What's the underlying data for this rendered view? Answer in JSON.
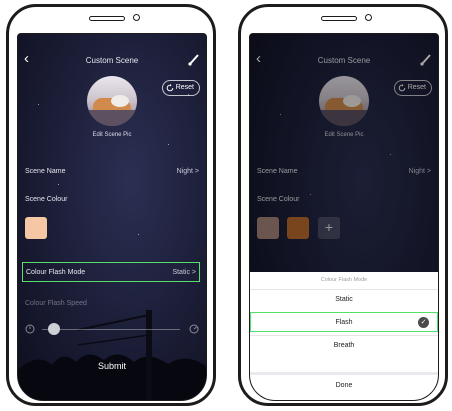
{
  "screen": {
    "title": "Custom Scene",
    "reset_label": "Reset",
    "edit_pic_label": "Edit Scene Pic",
    "scene_name_label": "Scene Name",
    "scene_name_value": "Night",
    "scene_colour_label": "Scene Colour",
    "flash_mode_label": "Colour Flash Mode",
    "flash_mode_value": "Static",
    "flash_speed_label": "Colour Flash Speed",
    "flash_speed_level": 0.05,
    "submit_label": "Submit",
    "left_swatches": [
      "#f6c7a4"
    ],
    "right_swatches": [
      "#a5857a",
      "#b86b2c"
    ],
    "add_colour_label": "+",
    "chevron": ">"
  },
  "sheet": {
    "title": "Colour Flash Mode",
    "options": [
      "Static",
      "Flash",
      "Breath"
    ],
    "selected": "Flash",
    "done_label": "Done"
  },
  "colors": {
    "highlight": "#55e06a",
    "screen_bg": "#1b1d36"
  },
  "icons": [
    "back-arrow-icon",
    "brush-icon",
    "reset-icon",
    "check-icon",
    "slow-speed-icon",
    "fast-speed-icon"
  ]
}
